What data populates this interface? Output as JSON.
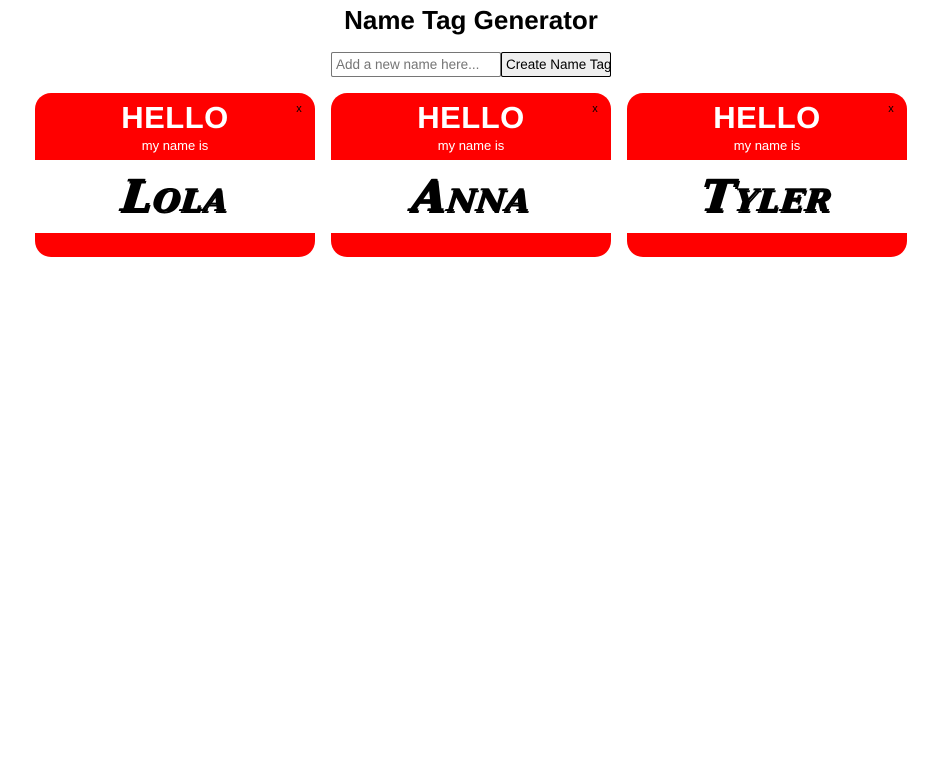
{
  "header": {
    "title": "Name Tag Generator"
  },
  "form": {
    "input_placeholder": "Add a new name here...",
    "input_value": "",
    "button_label": "Create Name Tag"
  },
  "name_tags": [
    {
      "greeting": "HELLO",
      "subtitle": "my name is",
      "name": "Lola",
      "close_label": "x"
    },
    {
      "greeting": "HELLO",
      "subtitle": "my name is",
      "name": "Anna",
      "close_label": "x"
    },
    {
      "greeting": "HELLO",
      "subtitle": "my name is",
      "name": "Tyler",
      "close_label": "x"
    }
  ],
  "colors": {
    "tag_red": "#ff0000",
    "tag_body": "#ffffff",
    "text_dark": "#000000"
  }
}
